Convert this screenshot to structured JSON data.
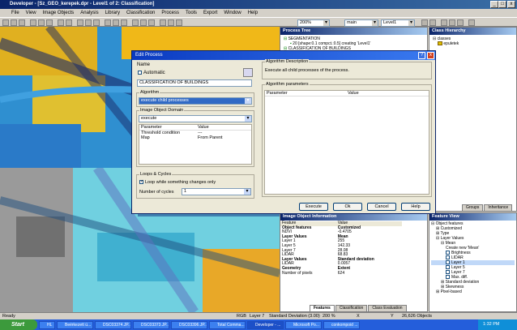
{
  "window": {
    "title": "Developer - [Sz_GEO_kerepek.dpr - Level1 of 2: Classification]"
  },
  "menu": [
    "File",
    "View",
    "Image Objects",
    "Analysis",
    "Library",
    "Classification",
    "Process",
    "Tools",
    "Export",
    "Window",
    "Help"
  ],
  "toolbar": {
    "zoom": "200%",
    "layer": "main",
    "level": "Level1"
  },
  "process_tree": {
    "title": "Process Tree",
    "items": [
      "SEGMENTATION",
      "20 [shape:0.1 compct.:0.5] creating 'Level1'",
      "CLASSIFICATION OF BUILDINGS"
    ]
  },
  "class_hierarchy": {
    "title": "Class Hierarchy",
    "items": [
      "classes",
      "epuletek"
    ],
    "tabs": [
      "Groups",
      "Inheritance"
    ],
    "swatch": "#e0c000"
  },
  "dialog": {
    "title": "Edit Process",
    "name_label": "Name",
    "automatic_label": "Automatic",
    "name_value": "CLASSIFICATION OF BUILDINGS",
    "algorithm_label": "Algorithm",
    "algorithm_value": "execute child processes",
    "domain_label": "Image Object Domain",
    "domain_value": "execute",
    "param_headers": [
      "Parameter",
      "Value"
    ],
    "params": [
      [
        "Threshold condition",
        "---"
      ],
      [
        "Map",
        "From Parent"
      ]
    ],
    "loops_label": "Loops & Cycles",
    "loop_label": "Loop while something changes only",
    "cycles_label": "Number of cycles",
    "cycles_value": "1",
    "alg_desc_label": "Algorithm Description",
    "alg_desc_text": "Execute all child processes of the process.",
    "alg_params_label": "Algorithm parameters",
    "alg_param_headers": [
      "Parameter",
      "Value"
    ],
    "buttons": {
      "execute": "Execute",
      "ok": "Ok",
      "cancel": "Cancel",
      "help": "Help"
    }
  },
  "image_object_info": {
    "title": "Image Object Information",
    "headers": [
      "Feature",
      "Value"
    ],
    "rows": [
      [
        "Object features",
        "Customized",
        true
      ],
      [
        "NDVI",
        "-0.4705",
        false
      ],
      [
        "Layer Values",
        "Mean",
        true
      ],
      [
        "Layer 1",
        "255",
        false
      ],
      [
        "Layer 5",
        "142.33",
        false
      ],
      [
        "Layer 7",
        "28.08",
        false
      ],
      [
        "LIDAR",
        "68.83",
        false
      ],
      [
        "Layer Values",
        "Standard deviation",
        true
      ],
      [
        "LIDAR",
        "0.0057",
        false
      ],
      [
        "Geometry",
        "Extent",
        true
      ],
      [
        "Number of pixels",
        "624",
        false
      ]
    ],
    "tabs": [
      "Features",
      "Classification",
      "Class Evaluation"
    ]
  },
  "feature_view": {
    "title": "Feature View",
    "items": [
      "Object features",
      "Customized",
      "Type",
      "Layer Values",
      "Mean",
      "Create new 'Mean'",
      "Brightness",
      "LIDAR",
      "Layer 1",
      "Layer 5",
      "Layer 7",
      "Max. diff.",
      "Standard deviation",
      "Skewness",
      "Pixel-based"
    ]
  },
  "status": {
    "ready": "Ready",
    "rgb": "RGB",
    "layer": "Layer 7",
    "sd": "Standard Deviation (3.00)",
    "zoom": "200 %",
    "x": "X",
    "y": "Y",
    "objects": "26,626 Objects"
  },
  "taskbar": {
    "start": "Start",
    "tasks": [
      "HL",
      "Beérkezett ü...",
      "DSC03374.JP...",
      "DSC03373.JP...",
      "DSC03396.JP...",
      "Total Comma...",
      "Developer - ...",
      "Microsoft Po...",
      "conkompoid ..."
    ],
    "time": "1:32 PM"
  }
}
